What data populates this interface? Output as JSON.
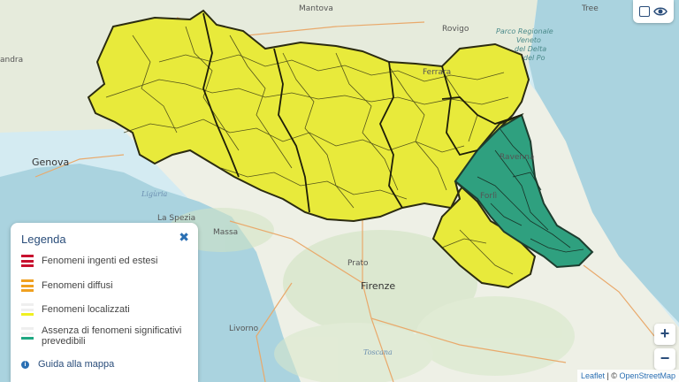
{
  "colors": {
    "yellow_zone": "#e8ea3b",
    "green_zone": "#2fa07f",
    "red": "#c8102e",
    "orange": "#f0a020",
    "yellow": "#f0f020",
    "green": "#1fa882"
  },
  "map_labels": {
    "mantova": "Mantova",
    "rovigo": "Rovigo",
    "genova": "Genova",
    "ferrara": "Ferrara",
    "ravenna": "Ravenna",
    "forli": "Forlì",
    "la_spezia": "La Spezia",
    "massa": "Massa",
    "prato": "Prato",
    "firenze": "Firenze",
    "livorno": "Livorno",
    "toscana": "Toscana",
    "liguria": "Ligùria",
    "sandra": "andra",
    "park": "Parco Regionale Veneto del Delta del Po",
    "park_line1": "Parco Regionale",
    "park_line2": "Veneto",
    "park_line3": "del Delta",
    "park_line4": "del Po",
    "tree": "Tree"
  },
  "layer_toggle": {
    "icon": "eye-icon"
  },
  "legend": {
    "title": "Legenda",
    "close_icon": "close-icon",
    "items": [
      {
        "label": "Fenomeni ingenti ed estesi",
        "color": "#c8102e"
      },
      {
        "label": "Fenomeni diffusi",
        "color": "#f0a020"
      },
      {
        "label": "Fenomeni localizzati",
        "color": "#f0f020"
      },
      {
        "label_line1": "Assenza di fenomeni significativi",
        "label_line2": "prevedibili",
        "color": "#1fa882"
      }
    ],
    "guide_label": "Guida alla mappa"
  },
  "zoom": {
    "in": "+",
    "out": "−"
  },
  "attribution": {
    "leaflet": "Leaflet",
    "sep": " | © ",
    "osm": "OpenStreetMap"
  }
}
